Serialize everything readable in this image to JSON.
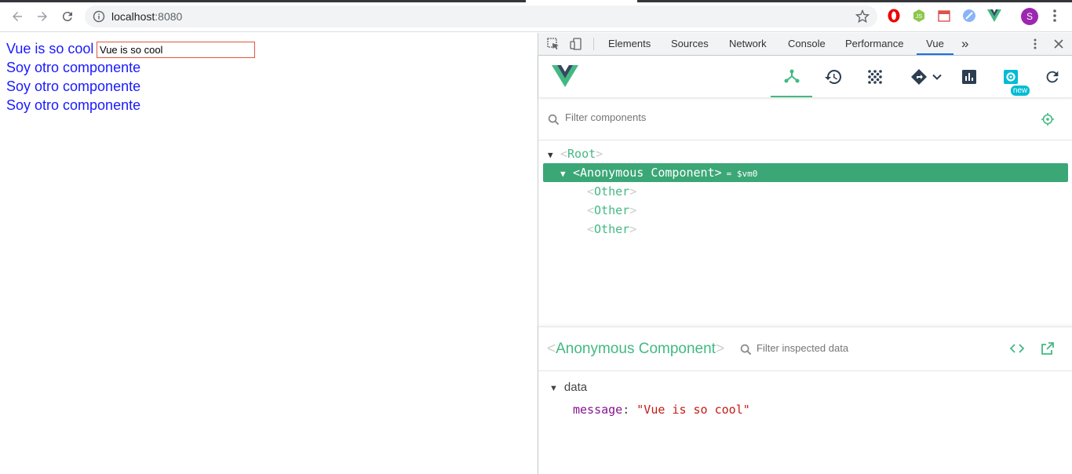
{
  "browser": {
    "url_host": "localhost",
    "url_port": ":8080",
    "avatar_letter": "S"
  },
  "page": {
    "title_text": "Vue is so cool",
    "input_value": "Vue is so cool",
    "other_lines": [
      "Soy otro componente",
      "Soy otro componente",
      "Soy otro componente"
    ]
  },
  "devtools": {
    "tabs": [
      "Elements",
      "Sources",
      "Network",
      "Console",
      "Performance",
      "Vue"
    ],
    "more_tabs": "»",
    "new_badge": "new",
    "filter_placeholder": "Filter components",
    "tree": {
      "root": "Root",
      "selected": "Anonymous Component",
      "selected_ref": "= $vm0",
      "children": [
        "Other",
        "Other",
        "Other"
      ]
    },
    "inspector": {
      "title": "Anonymous Component",
      "filter_placeholder": "Filter inspected data",
      "section": "data",
      "prop_key": "message",
      "prop_value": "\"Vue is so cool\""
    }
  },
  "colors": {
    "vue_green": "#42b983",
    "selected_row": "#3ba776",
    "link_blue": "#1a1aff"
  }
}
